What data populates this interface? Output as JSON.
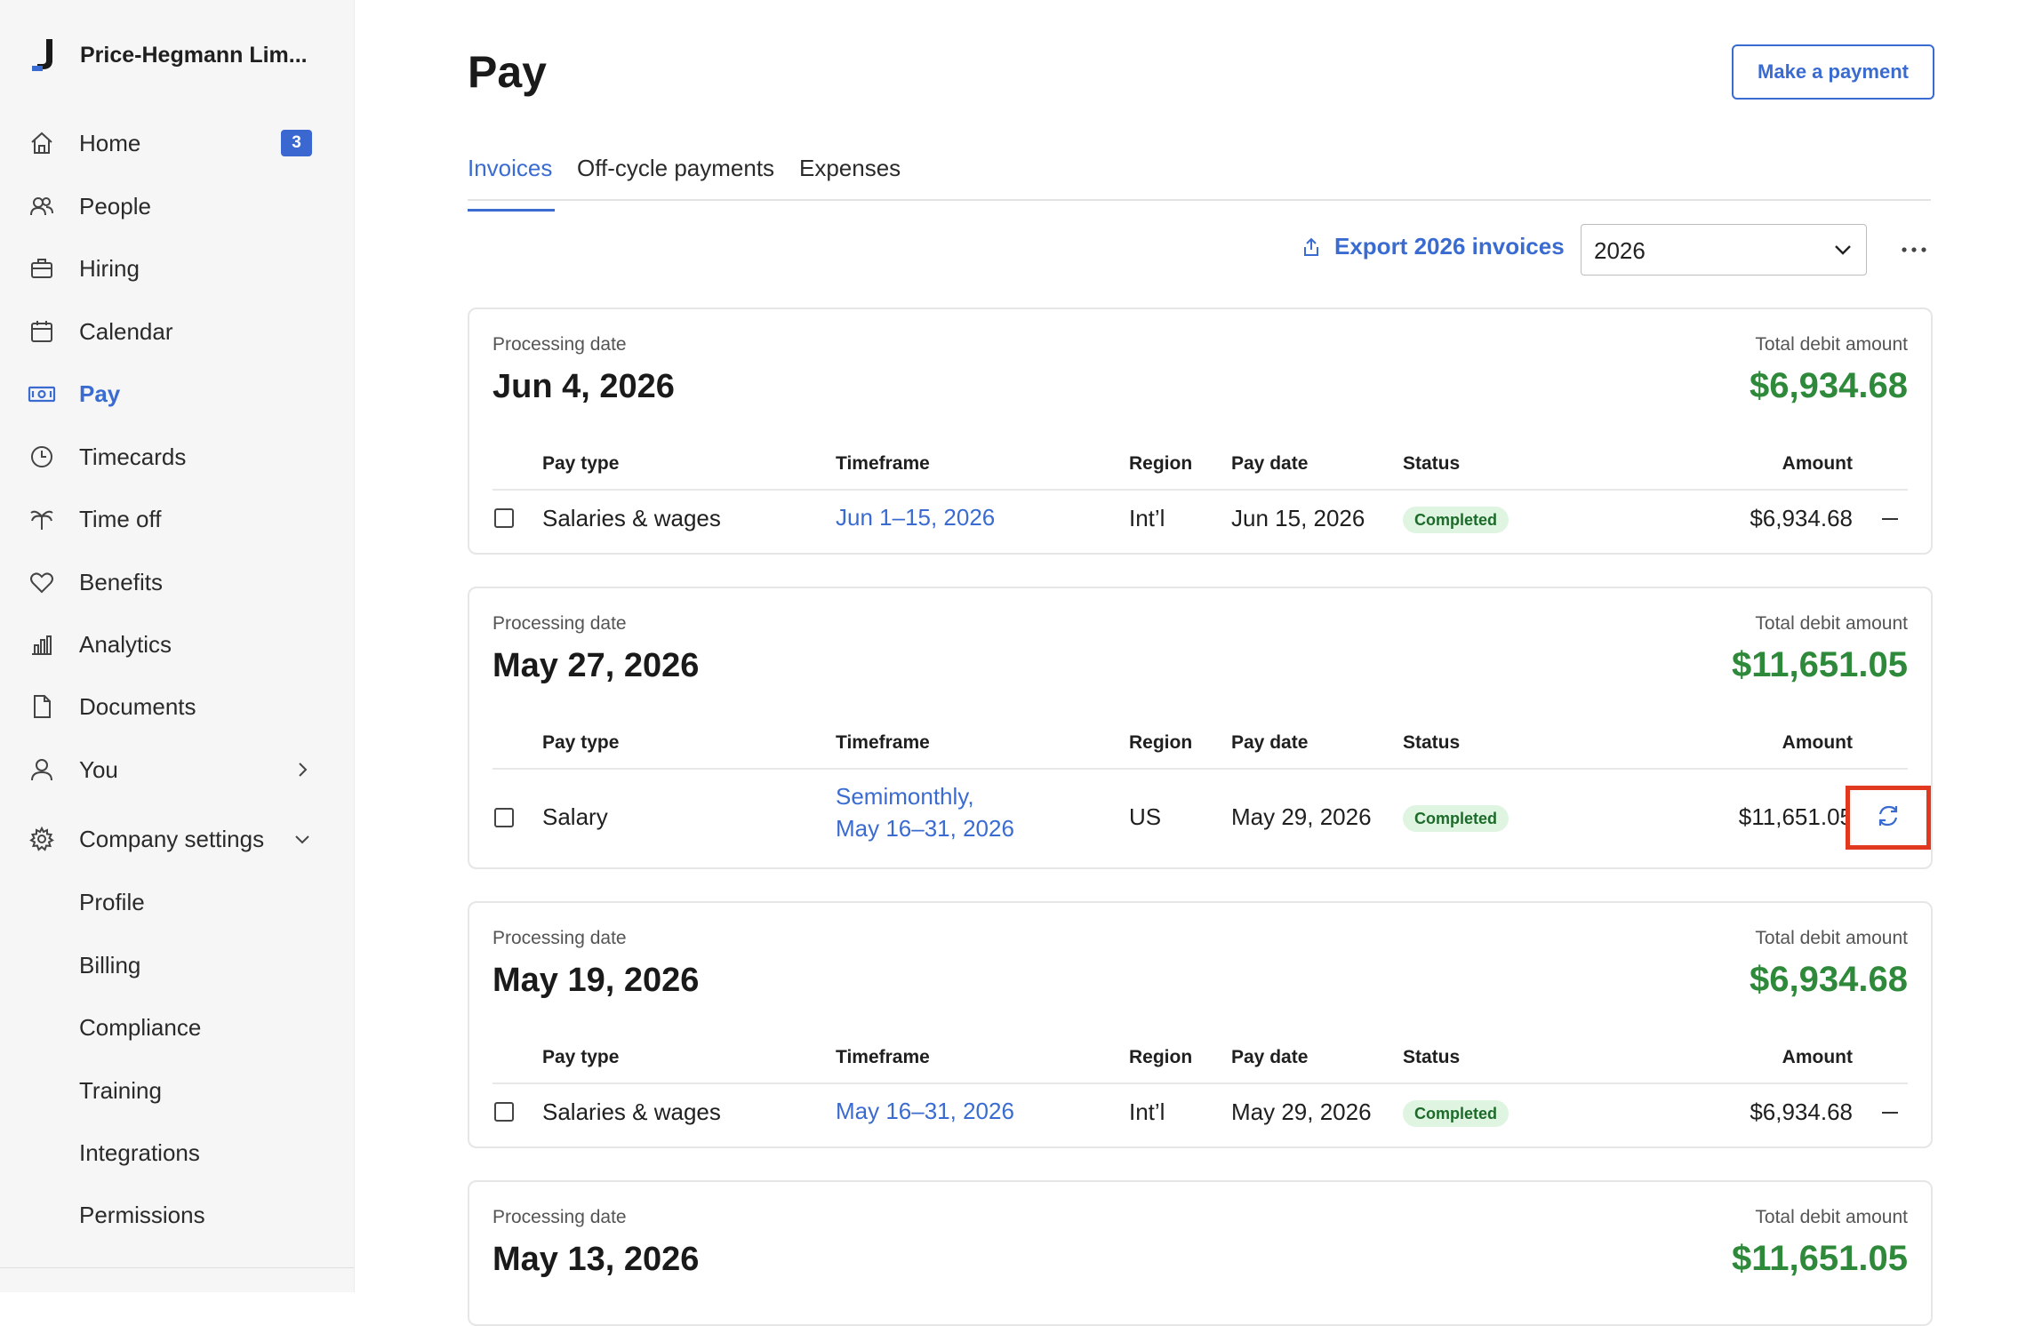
{
  "sidebar": {
    "company_name": "Price-Hegmann Lim...",
    "brand_icon": "j-logo-icon",
    "home_badge": "3",
    "nav": [
      {
        "label": "Home",
        "icon": "home-icon"
      },
      {
        "label": "People",
        "icon": "people-icon"
      },
      {
        "label": "Hiring",
        "icon": "briefcase-icon"
      },
      {
        "label": "Calendar",
        "icon": "calendar-icon"
      },
      {
        "label": "Pay",
        "icon": "money-icon",
        "active": true
      },
      {
        "label": "Timecards",
        "icon": "clock-icon"
      },
      {
        "label": "Time off",
        "icon": "palm-tree-icon"
      },
      {
        "label": "Benefits",
        "icon": "heart-icon"
      },
      {
        "label": "Analytics",
        "icon": "bar-chart-icon"
      },
      {
        "label": "Documents",
        "icon": "document-icon"
      },
      {
        "label": "You",
        "icon": "user-icon"
      },
      {
        "label": "Company settings",
        "icon": "gear-icon"
      }
    ],
    "settings_sub": [
      "Profile",
      "Billing",
      "Compliance",
      "Training",
      "Integrations",
      "Permissions"
    ]
  },
  "header": {
    "title": "Pay",
    "make_payment_label": "Make a payment"
  },
  "tabs": [
    "Invoices",
    "Off-cycle payments",
    "Expenses"
  ],
  "toolbar": {
    "export_label": "Export 2026 invoices",
    "year_value": "2026"
  },
  "colors": {
    "accent": "#3a6bd1",
    "total_green": "#2e8a3a",
    "status_bg": "#dff4e1",
    "highlight": "#e0391f"
  },
  "table_headers": {
    "pay_type": "Pay type",
    "timeframe": "Timeframe",
    "region": "Region",
    "pay_date": "Pay date",
    "status": "Status",
    "amount": "Amount"
  },
  "invoices": [
    {
      "processing_label": "Processing date",
      "processing_date": "Jun 4, 2026",
      "total_label": "Total debit amount",
      "total": "$6,934.68",
      "row": {
        "pay_type": "Salaries & wages",
        "timeframe_1": "Jun 1–15, 2026",
        "timeframe_2": "",
        "region": "Int’l",
        "pay_date": "Jun 15, 2026",
        "status": "Completed",
        "amount": "$6,934.68"
      }
    },
    {
      "processing_label": "Processing date",
      "processing_date": "May 27, 2026",
      "total_label": "Total debit amount",
      "total": "$11,651.05",
      "row": {
        "pay_type": "Salary",
        "timeframe_1": "Semimonthly,",
        "timeframe_2": "May 16–31, 2026",
        "region": "US",
        "pay_date": "May 29, 2026",
        "status": "Completed",
        "amount": "$11,651.05"
      }
    },
    {
      "processing_label": "Processing date",
      "processing_date": "May 19, 2026",
      "total_label": "Total debit amount",
      "total": "$6,934.68",
      "row": {
        "pay_type": "Salaries & wages",
        "timeframe_1": "May 16–31, 2026",
        "timeframe_2": "",
        "region": "Int’l",
        "pay_date": "May 29, 2026",
        "status": "Completed",
        "amount": "$6,934.68"
      }
    },
    {
      "processing_label": "Processing date",
      "processing_date": "May 13, 2026",
      "total_label": "Total debit amount",
      "total": "$11,651.05"
    }
  ]
}
